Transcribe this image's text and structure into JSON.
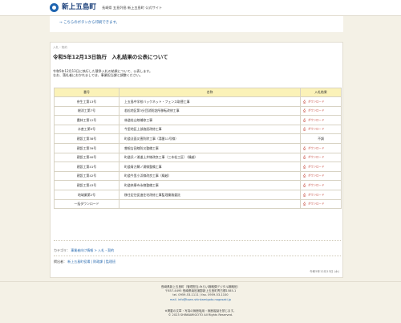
{
  "header": {
    "site_name": "新上五島町",
    "site_sub": "長崎県 五島列島 新上五島町 公式サイト"
  },
  "print_link": "→ こちらのボタンから印刷できます。",
  "breadcrumb": "入札・契約",
  "title": "令和5年12月13日執行　入札結果の公表について",
  "intro": [
    "令和5年12月13日に執行した競争入札の結果について、公表します。",
    "なお、落札者におかれましては、事業担当課と調整ください。"
  ],
  "table": {
    "headers": [
      "番号",
      "名称",
      "入札結果"
    ],
    "rows": [
      {
        "no": "奈生工第13号",
        "name": "上五島中学校バックネット・フェンス取替工事",
        "result": "ダウンロード",
        "pdf": true
      },
      {
        "no": "総消工第7号",
        "name": "若松地区第3分団消防詰所移転改修工事",
        "result": "ダウンロード",
        "pdf": true
      },
      {
        "no": "農林工第12号",
        "name": "林道桂山線補修工事",
        "result": "ダウンロード",
        "pdf": true
      },
      {
        "no": "水産工第9号",
        "name": "今里地区上部施設改修工事",
        "result": "ダウンロード",
        "pdf": true
      },
      {
        "no": "建設工第38号",
        "name": "町道法面災害防除工事（湯番11号線）",
        "result": "不調",
        "pdf": false
      },
      {
        "no": "建設工第39号",
        "name": "曽根吉田線防災整備工事",
        "result": "ダウンロード",
        "pdf": true
      },
      {
        "no": "建設工第40号",
        "name": "町道浜ノ浦道土井線改良工事（三本松工区）（繰越）",
        "result": "ダウンロード",
        "pdf": true
      },
      {
        "no": "建設工第41号",
        "name": "町道青方鯛ノ浦線整備工事",
        "result": "ダウンロード",
        "pdf": true
      },
      {
        "no": "建設工第42号",
        "name": "町道今里小浜線改良工事（繰越）",
        "result": "ダウンロード",
        "pdf": true
      },
      {
        "no": "建設工第43号",
        "name": "町道奈摩寺永線整備工事",
        "result": "ダウンロード",
        "pdf": true
      },
      {
        "no": "地域業第2号",
        "name": "移住定住促進住宅改修工事監理業務委託",
        "result": "ダウンロード",
        "pdf": true
      },
      {
        "no": "一括ダウンロード",
        "name": "",
        "result": "ダウンロード",
        "pdf": true
      }
    ]
  },
  "category_label": "カテゴリ：",
  "category_links": "事業者向け情報 > 入札・契約",
  "poster_label": "掲出者：",
  "poster_links": "新上五島町役場 | 財政課 | 監理班",
  "updated": "令和5年12月13日 (水)",
  "footer": {
    "lines": [
      "長崎県新上五島町（管理担当:みらい戦略課デジタル戦略班）",
      "〒857-4495 長崎県南松浦郡新上五島町青方郷1585-1",
      "tel. 0959-53-1111 / fax. 0959-53-1100",
      "mail. info@town.shinkamigoto.nagasaki.jp"
    ],
    "copyright": [
      "※掲載の文章・写真の無断転用・無断複製を禁じます。",
      "© 2023 SHINKAMIGOTO All Rights Reserved."
    ]
  }
}
